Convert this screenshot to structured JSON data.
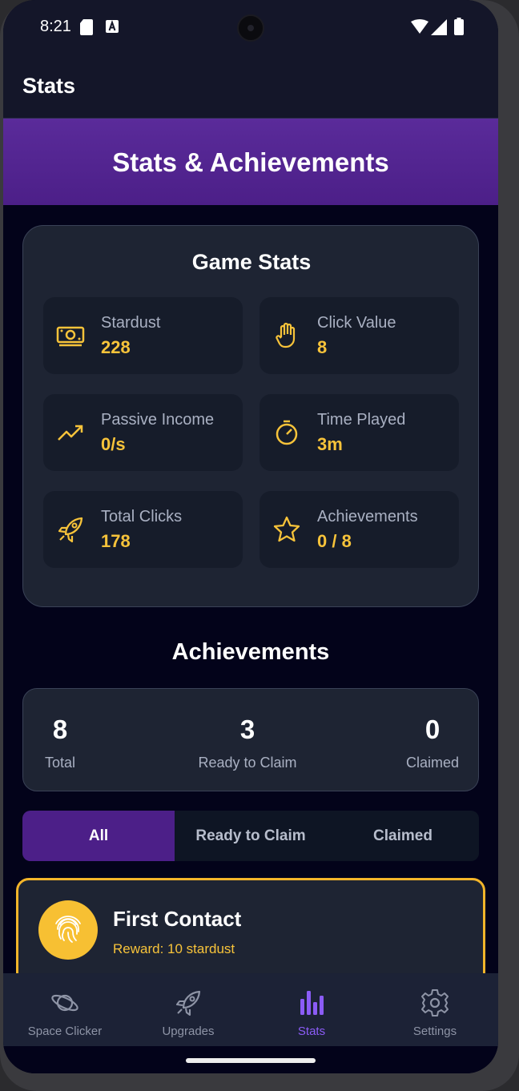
{
  "status_bar": {
    "time": "8:21"
  },
  "app_bar": {
    "title": "Stats"
  },
  "banner": {
    "title": "Stats & Achievements"
  },
  "game_stats": {
    "title": "Game Stats",
    "tiles": [
      {
        "label": "Stardust",
        "value": "228",
        "icon": "money-icon"
      },
      {
        "label": "Click Value",
        "value": "8",
        "icon": "hand-icon"
      },
      {
        "label": "Passive Income",
        "value": "0/s",
        "icon": "trending-up-icon"
      },
      {
        "label": "Time Played",
        "value": "3m",
        "icon": "timer-icon"
      },
      {
        "label": "Total Clicks",
        "value": "178",
        "icon": "rocket-icon"
      },
      {
        "label": "Achievements",
        "value": "0 / 8",
        "icon": "star-icon"
      }
    ]
  },
  "achievements": {
    "title": "Achievements",
    "summary": {
      "total": {
        "value": "8",
        "label": "Total"
      },
      "ready": {
        "value": "3",
        "label": "Ready to Claim"
      },
      "claimed": {
        "value": "0",
        "label": "Claimed"
      }
    },
    "filters": [
      {
        "label": "All",
        "active": true
      },
      {
        "label": "Ready to Claim",
        "active": false
      },
      {
        "label": "Claimed",
        "active": false
      }
    ],
    "items": [
      {
        "name": "First Contact",
        "reward": "Reward: 10 stardust",
        "icon": "fingerprint-icon"
      }
    ]
  },
  "bottom_nav": {
    "items": [
      {
        "label": "Space Clicker",
        "icon": "planet-icon",
        "active": false
      },
      {
        "label": "Upgrades",
        "icon": "rocket-icon",
        "active": false
      },
      {
        "label": "Stats",
        "icon": "bar-chart-icon",
        "active": true
      },
      {
        "label": "Settings",
        "icon": "gear-icon",
        "active": false
      }
    ]
  },
  "colors": {
    "accent_purple": "#4c1f88",
    "active_nav": "#8b5cf6",
    "value_gold": "#f7c33a",
    "card_bg": "#1e2433"
  }
}
